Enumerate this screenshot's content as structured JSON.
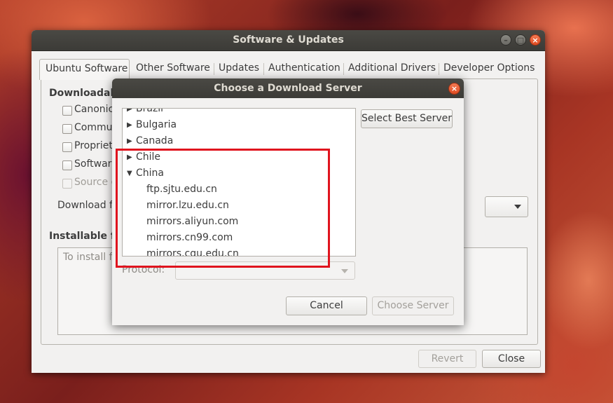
{
  "main_window": {
    "title": "Software & Updates",
    "controls": {
      "minimize": "–",
      "maximize": "□",
      "close": "×"
    },
    "tabs": [
      {
        "label": "Ubuntu Software",
        "active": true
      },
      {
        "label": "Other Software"
      },
      {
        "label": "Updates"
      },
      {
        "label": "Authentication"
      },
      {
        "label": "Additional Drivers"
      },
      {
        "label": "Developer Options"
      }
    ],
    "downloadable_heading": "Downloadab",
    "options": [
      {
        "label": "Canonica",
        "checked": false,
        "disabled": false
      },
      {
        "label": "Commun",
        "checked": false,
        "disabled": false
      },
      {
        "label": "Propriet",
        "checked": false,
        "disabled": false
      },
      {
        "label": "Softwar",
        "checked": false,
        "disabled": false
      },
      {
        "label": "Source c",
        "checked": false,
        "disabled": true
      }
    ],
    "download_from_label": "Download f",
    "installable_heading": "Installable f",
    "installable_placeholder": "To install f",
    "revert_button": "Revert",
    "close_button": "Close"
  },
  "dialog": {
    "title": "Choose a Download Server",
    "close_glyph": "×",
    "tree": [
      {
        "label": "Brazil",
        "expanded": false,
        "child": false
      },
      {
        "label": "Bulgaria",
        "expanded": false,
        "child": false
      },
      {
        "label": "Canada",
        "expanded": false,
        "child": false
      },
      {
        "label": "Chile",
        "expanded": false,
        "child": false
      },
      {
        "label": "China",
        "expanded": true,
        "child": false
      },
      {
        "label": "ftp.sjtu.edu.cn",
        "child": true
      },
      {
        "label": "mirror.lzu.edu.cn",
        "child": true
      },
      {
        "label": "mirrors.aliyun.com",
        "child": true
      },
      {
        "label": "mirrors.cn99.com",
        "child": true
      },
      {
        "label": "mirrors.cqu.edu.cn",
        "child": true
      }
    ],
    "select_best_server": "Select Best Server",
    "protocol_label": "Protocol:",
    "protocol_value": "",
    "cancel_button": "Cancel",
    "choose_server_button": "Choose Server"
  },
  "colors": {
    "annotation": "#e0141e",
    "titlebar": "#3c3b37",
    "close_button": "#df4b21"
  }
}
